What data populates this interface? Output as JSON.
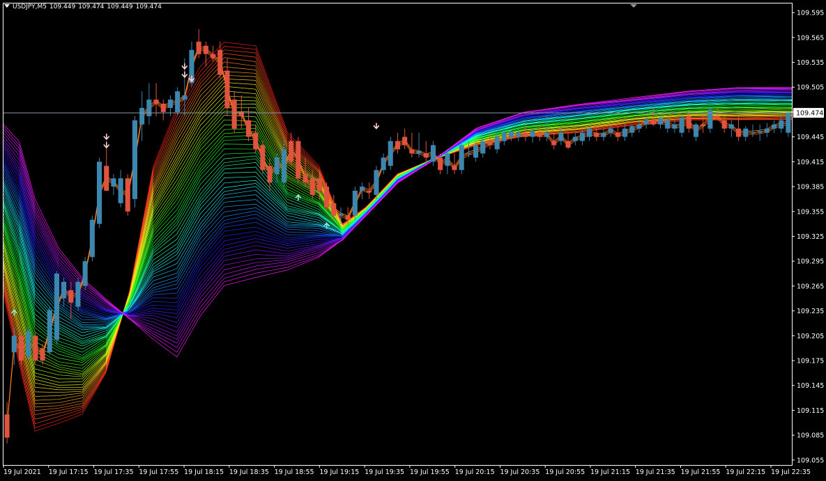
{
  "header": {
    "symbol": "USDJPY,M5",
    "ohlc": [
      "109.449",
      "109.474",
      "109.449",
      "109.474"
    ]
  },
  "price_marker": "109.474",
  "colors": {
    "background": "#000000",
    "frame": "#ffffff",
    "bull_candle": "#3d86ad",
    "bear_candle": "#e0543f",
    "current_price_line": "#8a9aa8",
    "sell_arrow": "#ffd3d3",
    "buy_arrow": "#8ef0d8"
  },
  "chart_data": {
    "type": "line",
    "symbol": "USDJPY",
    "timeframe": "M5",
    "x_tick_labels": [
      "19 Jul 2021",
      "19 Jul 17:15",
      "19 Jul 17:35",
      "19 Jul 17:55",
      "19 Jul 18:15",
      "19 Jul 18:35",
      "19 Jul 18:55",
      "19 Jul 19:15",
      "19 Jul 19:35",
      "19 Jul 19:55",
      "19 Jul 20:15",
      "19 Jul 20:35",
      "19 Jul 20:55",
      "19 Jul 21:15",
      "19 Jul 21:35",
      "19 Jul 21:55",
      "19 Jul 22:15",
      "19 Jul 22:35"
    ],
    "y_tick_labels": [
      "109.595",
      "109.565",
      "109.535",
      "109.505",
      "109.475",
      "109.445",
      "109.415",
      "109.385",
      "109.355",
      "109.325",
      "109.295",
      "109.265",
      "109.235",
      "109.205",
      "109.175",
      "109.145",
      "109.115",
      "109.085",
      "109.055"
    ],
    "ylim": [
      109.049,
      109.606
    ],
    "current_price": 109.474,
    "candles": [
      [
        109.11,
        109.125,
        109.075,
        109.082
      ],
      [
        109.185,
        109.215,
        109.17,
        109.205
      ],
      [
        109.205,
        109.208,
        109.17,
        109.175
      ],
      [
        109.18,
        109.215,
        109.175,
        109.21
      ],
      [
        109.205,
        109.21,
        109.172,
        109.175
      ],
      [
        109.19,
        109.195,
        109.17,
        109.175
      ],
      [
        109.185,
        109.24,
        109.182,
        109.236
      ],
      [
        109.2,
        109.283,
        109.195,
        109.28
      ],
      [
        109.25,
        109.275,
        109.24,
        109.27
      ],
      [
        109.26,
        109.27,
        109.225,
        109.245
      ],
      [
        109.24,
        109.275,
        109.235,
        109.27
      ],
      [
        109.265,
        109.3,
        109.26,
        109.295
      ],
      [
        109.3,
        109.35,
        109.295,
        109.345
      ],
      [
        109.34,
        109.42,
        109.335,
        109.415
      ],
      [
        109.41,
        109.44,
        109.38,
        109.38
      ],
      [
        109.385,
        109.4,
        109.375,
        109.395
      ],
      [
        109.365,
        109.405,
        109.36,
        109.395
      ],
      [
        109.395,
        109.4,
        109.35,
        109.355
      ],
      [
        109.37,
        109.47,
        109.36,
        109.465
      ],
      [
        109.46,
        109.5,
        109.44,
        109.48
      ],
      [
        109.47,
        109.51,
        109.46,
        109.49
      ],
      [
        109.49,
        109.51,
        109.47,
        109.485
      ],
      [
        109.485,
        109.49,
        109.465,
        109.475
      ],
      [
        109.48,
        109.495,
        109.47,
        109.49
      ],
      [
        109.475,
        109.505,
        109.47,
        109.5
      ],
      [
        109.49,
        109.54,
        109.47,
        109.495
      ],
      [
        109.51,
        109.56,
        109.505,
        109.55
      ],
      [
        109.56,
        109.575,
        109.54,
        109.545
      ],
      [
        109.555,
        109.56,
        109.53,
        109.545
      ],
      [
        109.545,
        109.555,
        109.535,
        109.54
      ],
      [
        109.55,
        109.56,
        109.515,
        109.52
      ],
      [
        109.525,
        109.54,
        109.47,
        109.48
      ],
      [
        109.49,
        109.5,
        109.45,
        109.455
      ],
      [
        109.475,
        109.495,
        109.455,
        109.47
      ],
      [
        109.465,
        109.48,
        109.44,
        109.445
      ],
      [
        109.45,
        109.46,
        109.425,
        109.43
      ],
      [
        109.435,
        109.44,
        109.4,
        109.405
      ],
      [
        109.41,
        109.42,
        109.38,
        109.39
      ],
      [
        109.4,
        109.425,
        109.39,
        109.42
      ],
      [
        109.39,
        109.44,
        109.385,
        109.43
      ],
      [
        109.44,
        109.45,
        109.41,
        109.415
      ],
      [
        109.44,
        109.445,
        109.39,
        109.395
      ],
      [
        109.4,
        109.42,
        109.385,
        109.39
      ],
      [
        109.395,
        109.405,
        109.37,
        109.375
      ],
      [
        109.395,
        109.4,
        109.37,
        109.38
      ],
      [
        109.385,
        109.39,
        109.355,
        109.36
      ],
      [
        109.365,
        109.375,
        109.345,
        109.35
      ],
      [
        109.35,
        109.36,
        109.34,
        109.352
      ],
      [
        109.35,
        109.36,
        109.34,
        109.345
      ],
      [
        109.35,
        109.385,
        109.345,
        109.38
      ],
      [
        109.38,
        109.39,
        109.37,
        109.385
      ],
      [
        109.38,
        109.39,
        109.37,
        109.378
      ],
      [
        109.375,
        109.41,
        109.37,
        109.405
      ],
      [
        109.405,
        109.425,
        109.4,
        109.42
      ],
      [
        109.41,
        109.445,
        109.405,
        109.44
      ],
      [
        109.44,
        109.45,
        109.425,
        109.43
      ],
      [
        109.445,
        109.455,
        109.43,
        109.435
      ],
      [
        109.43,
        109.45,
        109.42,
        109.425
      ],
      [
        109.425,
        109.45,
        109.42,
        109.428
      ],
      [
        109.425,
        109.44,
        109.41,
        109.42
      ],
      [
        109.415,
        109.44,
        109.41,
        109.435
      ],
      [
        109.42,
        109.425,
        109.4,
        109.405
      ],
      [
        109.41,
        109.43,
        109.4,
        109.425
      ],
      [
        109.41,
        109.425,
        109.4,
        109.405
      ],
      [
        109.405,
        109.44,
        109.4,
        109.435
      ],
      [
        109.425,
        109.44,
        109.42,
        109.425
      ],
      [
        109.42,
        109.44,
        109.415,
        109.435
      ],
      [
        109.425,
        109.445,
        109.42,
        109.44
      ],
      [
        109.44,
        109.45,
        109.43,
        109.435
      ],
      [
        109.43,
        109.45,
        109.425,
        109.445
      ],
      [
        109.44,
        109.455,
        109.435,
        109.45
      ],
      [
        109.445,
        109.455,
        109.44,
        109.452
      ],
      [
        109.445,
        109.455,
        109.44,
        109.45
      ],
      [
        109.45,
        109.46,
        109.44,
        109.445
      ],
      [
        109.445,
        109.455,
        109.438,
        109.452
      ],
      [
        109.45,
        109.46,
        109.44,
        109.445
      ],
      [
        109.445,
        109.47,
        109.44,
        109.45
      ],
      [
        109.44,
        109.45,
        109.43,
        109.435
      ],
      [
        109.44,
        109.455,
        109.435,
        109.45
      ],
      [
        109.44,
        109.45,
        109.43,
        109.432
      ],
      [
        109.44,
        109.45,
        109.435,
        109.445
      ],
      [
        109.44,
        109.455,
        109.435,
        109.45
      ],
      [
        109.445,
        109.46,
        109.44,
        109.455
      ],
      [
        109.45,
        109.46,
        109.44,
        109.445
      ],
      [
        109.445,
        109.455,
        109.44,
        109.45
      ],
      [
        109.45,
        109.46,
        109.445,
        109.455
      ],
      [
        109.45,
        109.458,
        109.44,
        109.445
      ],
      [
        109.445,
        109.46,
        109.44,
        109.455
      ],
      [
        109.45,
        109.46,
        109.445,
        109.458
      ],
      [
        109.455,
        109.465,
        109.45,
        109.46
      ],
      [
        109.46,
        109.47,
        109.455,
        109.465
      ],
      [
        109.465,
        109.48,
        109.458,
        109.46
      ],
      [
        109.46,
        109.472,
        109.455,
        109.468
      ],
      [
        109.455,
        109.47,
        109.45,
        109.465
      ],
      [
        109.455,
        109.465,
        109.45,
        109.46
      ],
      [
        109.45,
        109.47,
        109.445,
        109.468
      ],
      [
        109.47,
        109.475,
        109.45,
        109.455
      ],
      [
        109.445,
        109.462,
        109.44,
        109.46
      ],
      [
        109.46,
        109.47,
        109.45,
        109.458
      ],
      [
        109.455,
        109.48,
        109.45,
        109.478
      ],
      [
        109.47,
        109.48,
        109.465,
        109.468
      ],
      [
        109.465,
        109.47,
        109.45,
        109.455
      ],
      [
        109.455,
        109.465,
        109.445,
        109.46
      ],
      [
        109.455,
        109.47,
        109.44,
        109.445
      ],
      [
        109.445,
        109.458,
        109.44,
        109.455
      ],
      [
        109.45,
        109.46,
        109.445,
        109.45
      ],
      [
        109.45,
        109.46,
        109.44,
        109.452
      ],
      [
        109.45,
        109.462,
        109.445,
        109.455
      ],
      [
        109.455,
        109.465,
        109.45,
        109.46
      ],
      [
        109.455,
        109.47,
        109.45,
        109.465
      ],
      [
        109.45,
        109.475,
        109.445,
        109.474
      ]
    ],
    "bands": {
      "count": 60,
      "hue_start": 0,
      "hue_end": 300,
      "shape": [
        [
          0.0,
          109.255,
          109.46
        ],
        [
          0.02,
          109.17,
          109.44
        ],
        [
          0.04,
          109.09,
          109.37
        ],
        [
          0.07,
          109.1,
          109.31
        ],
        [
          0.1,
          109.11,
          109.275
        ],
        [
          0.13,
          109.16,
          109.25
        ],
        [
          0.16,
          109.26,
          109.225
        ],
        [
          0.19,
          109.41,
          109.2
        ],
        [
          0.22,
          109.48,
          109.18
        ],
        [
          0.25,
          109.53,
          109.23
        ],
        [
          0.28,
          109.56,
          109.265
        ],
        [
          0.32,
          109.555,
          109.275
        ],
        [
          0.36,
          109.45,
          109.285
        ],
        [
          0.4,
          109.41,
          109.3
        ],
        [
          0.43,
          109.34,
          109.32
        ],
        [
          0.46,
          109.36,
          109.35
        ],
        [
          0.5,
          109.4,
          109.39
        ],
        [
          0.55,
          109.42,
          109.42
        ],
        [
          0.6,
          109.435,
          109.455
        ],
        [
          0.66,
          109.445,
          109.475
        ],
        [
          0.73,
          109.45,
          109.485
        ],
        [
          0.8,
          109.46,
          109.492
        ],
        [
          0.87,
          109.465,
          109.5
        ],
        [
          0.93,
          109.465,
          109.505
        ],
        [
          1.0,
          109.466,
          109.505
        ]
      ]
    },
    "sell_arrows": [
      [
        109.445,
        2
      ],
      [
        109.53,
        2
      ],
      [
        109.515,
        1
      ],
      [
        109.458,
        1
      ]
    ],
    "buy_arrows": [
      [
        109.233,
        1
      ],
      [
        109.372,
        1
      ],
      [
        109.338,
        1
      ]
    ]
  }
}
